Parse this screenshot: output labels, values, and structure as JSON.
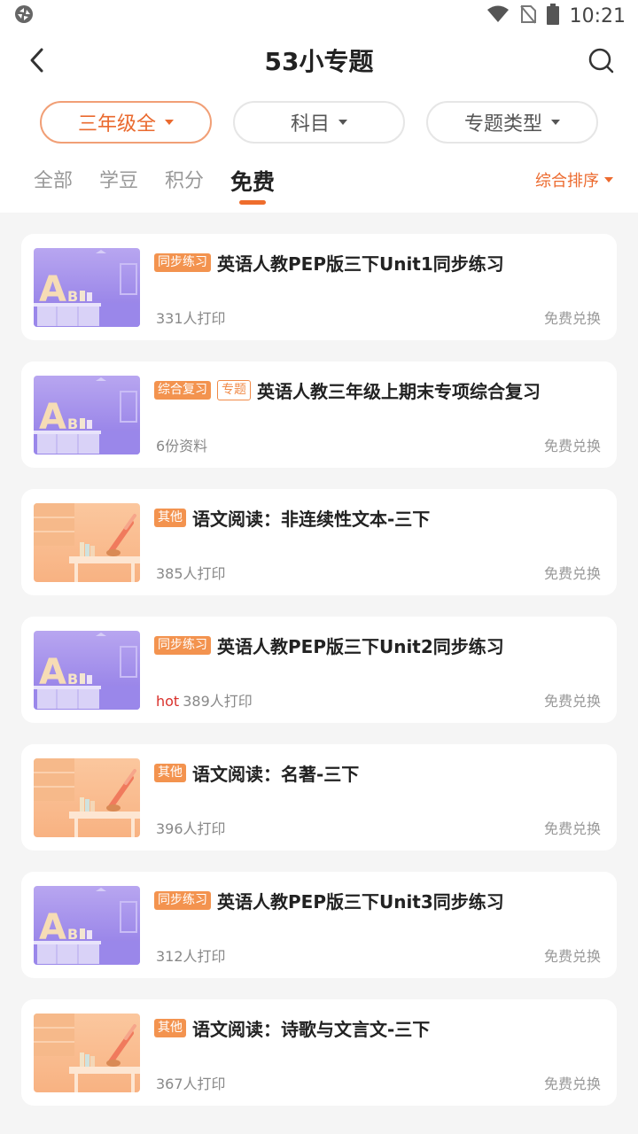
{
  "status": {
    "time": "10:21"
  },
  "header": {
    "title": "53小专题"
  },
  "filters": [
    {
      "label": "三年级全",
      "active": true
    },
    {
      "label": "科目",
      "active": false
    },
    {
      "label": "专题类型",
      "active": false
    }
  ],
  "tabs": [
    {
      "label": "全部",
      "active": false
    },
    {
      "label": "学豆",
      "active": false
    },
    {
      "label": "积分",
      "active": false
    },
    {
      "label": "免费",
      "active": true
    }
  ],
  "sort": {
    "label": "综合排序"
  },
  "items": [
    {
      "thumb": "english",
      "tags": [
        {
          "text": "同步练习",
          "style": "fill"
        }
      ],
      "title": "英语人教PEP版三下Unit1同步练习",
      "hot": "",
      "meta": "331人打印",
      "action": "免费兑换"
    },
    {
      "thumb": "english",
      "tags": [
        {
          "text": "综合复习",
          "style": "fill"
        },
        {
          "text": "专题",
          "style": "outline"
        }
      ],
      "title": "英语人教三年级上期末专项综合复习",
      "hot": "",
      "meta": "6份资料",
      "action": "免费兑换"
    },
    {
      "thumb": "chinese",
      "tags": [
        {
          "text": "其他",
          "style": "fill"
        }
      ],
      "title": "语文阅读：非连续性文本-三下",
      "hot": "",
      "meta": "385人打印",
      "action": "免费兑换"
    },
    {
      "thumb": "english",
      "tags": [
        {
          "text": "同步练习",
          "style": "fill"
        }
      ],
      "title": "英语人教PEP版三下Unit2同步练习",
      "hot": "hot",
      "meta": "389人打印",
      "action": "免费兑换"
    },
    {
      "thumb": "chinese",
      "tags": [
        {
          "text": "其他",
          "style": "fill"
        }
      ],
      "title": "语文阅读：名著-三下",
      "hot": "",
      "meta": "396人打印",
      "action": "免费兑换"
    },
    {
      "thumb": "english",
      "tags": [
        {
          "text": "同步练习",
          "style": "fill"
        }
      ],
      "title": "英语人教PEP版三下Unit3同步练习",
      "hot": "",
      "meta": "312人打印",
      "action": "免费兑换"
    },
    {
      "thumb": "chinese",
      "tags": [
        {
          "text": "其他",
          "style": "fill"
        }
      ],
      "title": "语文阅读：诗歌与文言文-三下",
      "hot": "",
      "meta": "367人打印",
      "action": "免费兑换"
    }
  ]
}
